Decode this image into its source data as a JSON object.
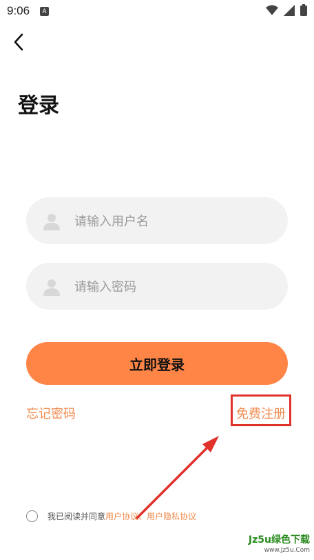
{
  "status_bar": {
    "time": "9:06",
    "notification_glyph": "A",
    "icons": [
      "wifi-icon",
      "signal-icon",
      "battery-icon"
    ]
  },
  "nav": {
    "back_icon": "back-arrow-icon"
  },
  "page": {
    "title": "登录"
  },
  "form": {
    "username_placeholder": "请输入用户名",
    "username_value": "",
    "password_placeholder": "请输入密码",
    "password_value": "",
    "field_icon": "user-icon",
    "login_label": "立即登录"
  },
  "links": {
    "forgot_label": "忘记密码",
    "register_label": "免费注册"
  },
  "agreement": {
    "prefix": "我已阅读并同意",
    "user_agreement": "用户协议",
    "separator": "、",
    "privacy": "用户隐私协议",
    "checked": false
  },
  "watermark": {
    "main": "Jz5u绿色下载",
    "sub": "www.Jz5u.Com"
  },
  "colors": {
    "accent": "#ff8547",
    "link": "#f08a4e",
    "field_bg": "#f2f2f2",
    "highlight": "#e0312b"
  }
}
